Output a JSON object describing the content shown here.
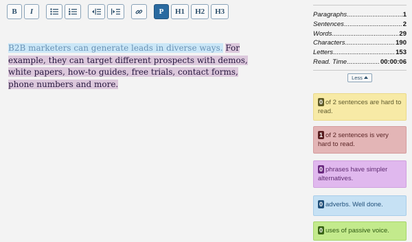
{
  "toolbar": {
    "bold": "B",
    "italic": "I",
    "paragraph": "P",
    "h1": "H1",
    "h2": "H2",
    "h3": "H3"
  },
  "editor": {
    "sentence1": "B2B marketers can generate leads in diverse ways.",
    "sentence2": "For example, they can target different prospects with demos, white papers, how-to guides, free trials, contact forms, phone numbers and more."
  },
  "stats": [
    {
      "label": "Paragraphs",
      "value": "1"
    },
    {
      "label": "Sentences",
      "value": "2"
    },
    {
      "label": "Words",
      "value": "29"
    },
    {
      "label": "Characters",
      "value": "190"
    },
    {
      "label": "Letters",
      "value": "153"
    },
    {
      "label": "Read. Time",
      "value": "00:00:06"
    }
  ],
  "less_button": "Less",
  "cards": {
    "hard": {
      "count": "0",
      "text": "of 2 sentences are hard to read."
    },
    "very_hard": {
      "count": "1",
      "text": "of 2 sentences is very hard to read."
    },
    "phrases": {
      "count": "0",
      "text": "phrases have simpler alternatives."
    },
    "adverbs": {
      "count": "0",
      "text": "adverbs. Well done."
    },
    "passive": {
      "count": "0",
      "text": "uses of passive voice."
    }
  },
  "colors": {
    "active_button": "#2a6aa0",
    "hard_card": "#f7eaa6",
    "very_hard_card": "#e3b5b6",
    "phrases_card": "#e0b8ee",
    "adverbs_card": "#c6e1f4",
    "passive_card": "#c3ea8c"
  }
}
